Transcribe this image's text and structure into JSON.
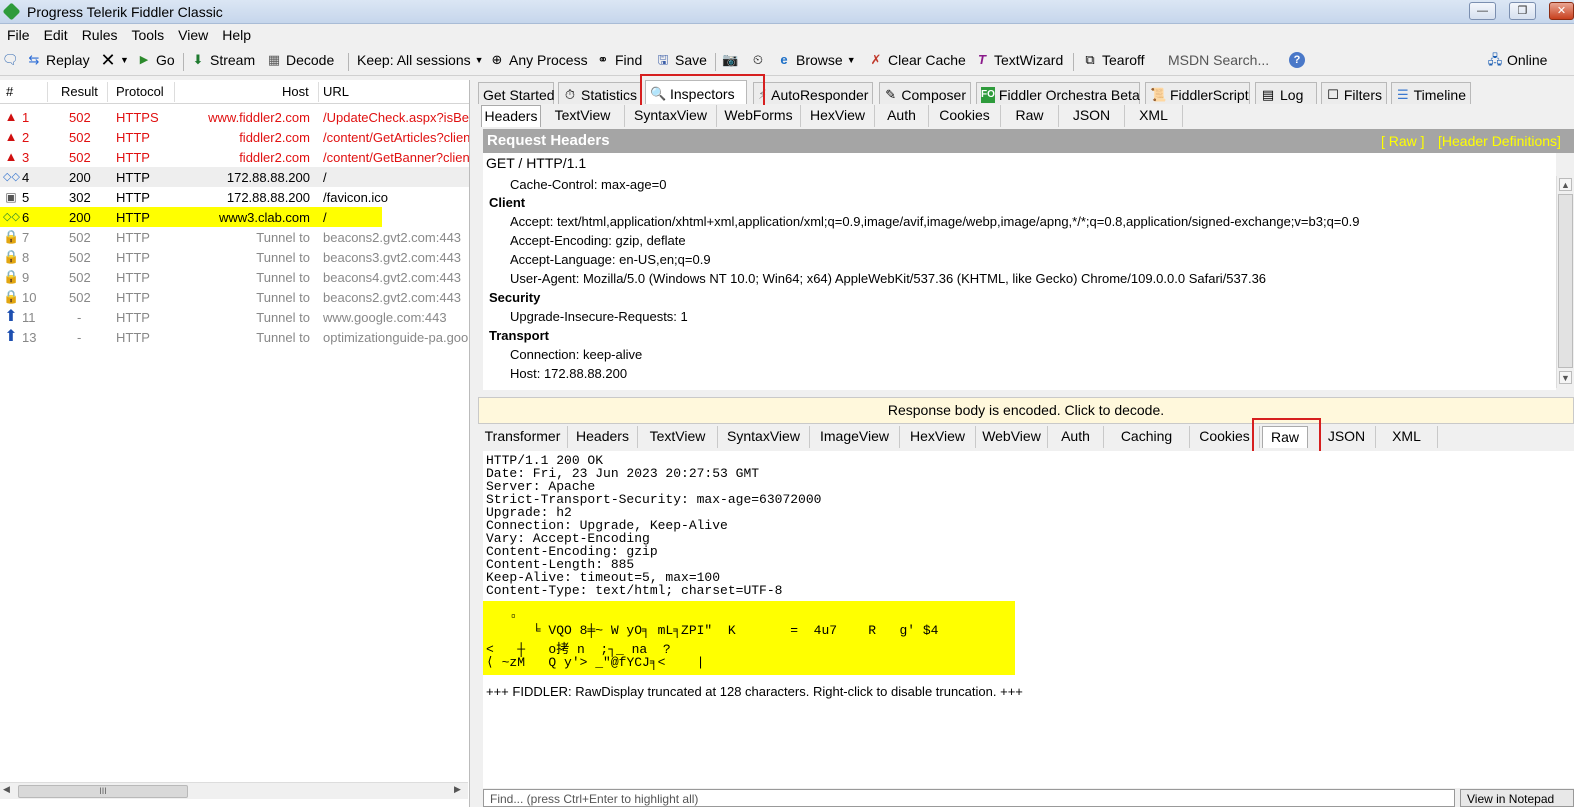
{
  "window": {
    "title": "Progress Telerik Fiddler Classic"
  },
  "menu": [
    "File",
    "Edit",
    "Rules",
    "Tools",
    "View",
    "Help"
  ],
  "toolbar": {
    "replay": "Replay",
    "go": "Go",
    "stream": "Stream",
    "decode": "Decode",
    "keep": "Keep: All sessions",
    "any_process": "Any Process",
    "find": "Find",
    "save": "Save",
    "browse": "Browse",
    "clear_cache": "Clear Cache",
    "textwizard": "TextWizard",
    "tearoff": "Tearoff",
    "msdn_search": "MSDN Search...",
    "online": "Online"
  },
  "sessions": {
    "columns": {
      "num": "#",
      "result": "Result",
      "protocol": "Protocol",
      "host": "Host",
      "url": "URL"
    },
    "rows": [
      {
        "num": "1",
        "result": "502",
        "protocol": "HTTPS",
        "host": "www.fiddler2.com",
        "url": "/UpdateCheck.aspx?isBet"
      },
      {
        "num": "2",
        "result": "502",
        "protocol": "HTTP",
        "host": "fiddler2.com",
        "url": "/content/GetArticles?clien"
      },
      {
        "num": "3",
        "result": "502",
        "protocol": "HTTP",
        "host": "fiddler2.com",
        "url": "/content/GetBanner?clien"
      },
      {
        "num": "4",
        "result": "200",
        "protocol": "HTTP",
        "host": "172.88.88.200",
        "url": "/"
      },
      {
        "num": "5",
        "result": "302",
        "protocol": "HTTP",
        "host": "172.88.88.200",
        "url": "/favicon.ico"
      },
      {
        "num": "6",
        "result": "200",
        "protocol": "HTTP",
        "host": "www3.clab.com",
        "url": "/"
      },
      {
        "num": "7",
        "result": "502",
        "protocol": "HTTP",
        "host": "Tunnel to",
        "url": "beacons2.gvt2.com:443"
      },
      {
        "num": "8",
        "result": "502",
        "protocol": "HTTP",
        "host": "Tunnel to",
        "url": "beacons3.gvt2.com:443"
      },
      {
        "num": "9",
        "result": "502",
        "protocol": "HTTP",
        "host": "Tunnel to",
        "url": "beacons4.gvt2.com:443"
      },
      {
        "num": "10",
        "result": "502",
        "protocol": "HTTP",
        "host": "Tunnel to",
        "url": "beacons2.gvt2.com:443"
      },
      {
        "num": "11",
        "result": "-",
        "protocol": "HTTP",
        "host": "Tunnel to",
        "url": "www.google.com:443"
      },
      {
        "num": "13",
        "result": "-",
        "protocol": "HTTP",
        "host": "Tunnel to",
        "url": "optimizationguide-pa.goo"
      }
    ],
    "scroll_thumb": "III"
  },
  "main_tabs": [
    "Get Started",
    "Statistics",
    "Inspectors",
    "AutoResponder",
    "Composer",
    "Fiddler Orchestra Beta",
    "FiddlerScript",
    "Log",
    "Filters",
    "Timeline"
  ],
  "fo_badge": "FO",
  "request_tabs": [
    "Headers",
    "TextView",
    "SyntaxView",
    "WebForms",
    "HexView",
    "Auth",
    "Cookies",
    "Raw",
    "JSON",
    "XML"
  ],
  "request_headers": {
    "title": "Request Headers",
    "raw_link": "[ Raw ]",
    "defs_link": "[Header Definitions]",
    "request_line": "GET / HTTP/1.1",
    "cache_control": "Cache-Control: max-age=0",
    "client_label": "Client",
    "accept": "Accept: text/html,application/xhtml+xml,application/xml;q=0.9,image/avif,image/webp,image/apng,*/*;q=0.8,application/signed-exchange;v=b3;q=0.9",
    "accept_encoding": "Accept-Encoding: gzip, deflate",
    "accept_language": "Accept-Language: en-US,en;q=0.9",
    "user_agent": "User-Agent: Mozilla/5.0 (Windows NT 10.0; Win64; x64) AppleWebKit/537.36 (KHTML, like Gecko) Chrome/109.0.0.0 Safari/537.36",
    "security_label": "Security",
    "upgrade_insecure": "Upgrade-Insecure-Requests: 1",
    "transport_label": "Transport",
    "connection": "Connection: keep-alive",
    "host": "Host: 172.88.88.200"
  },
  "decode_notice": "Response body is encoded. Click to decode.",
  "response_tabs": [
    "Transformer",
    "Headers",
    "TextView",
    "SyntaxView",
    "ImageView",
    "HexView",
    "WebView",
    "Auth",
    "Caching",
    "Cookies",
    "Raw",
    "JSON",
    "XML"
  ],
  "response_raw": {
    "headers": "HTTP/1.1 200 OK\nDate: Fri, 23 Jun 2023 20:27:53 GMT\nServer: Apache\nStrict-Transport-Security: max-age=63072000\nUpgrade: h2\nConnection: Upgrade, Keep-Alive\nVary: Accept-Encoding\nContent-Encoding: gzip\nContent-Length: 885\nKeep-Alive: timeout=5, max=100\nContent-Type: text/html; charset=UTF-8",
    "binary_line1": "   ▫",
    "binary_line2": "      ╘ VQO 8╪~ W yO╕ mL╕ZPI\"  K       =  4u7    R   g' $4",
    "binary_line3": "<   ┼   o拷 n  ;┐_ na  ?",
    "binary_line4": "⟨ ~zM   Q y'> _\"@fYCJ╕<    |",
    "truncation_note": "+++ FIDDLER: RawDisplay truncated at 128 characters. Right-click to disable truncation. +++"
  },
  "find_placeholder": "Find... (press Ctrl+Enter to highlight all)",
  "notepad_button": "View in Notepad",
  "colors": {
    "error_red": "#e01010",
    "highlight_yellow": "#ffff00",
    "callout_red": "#d61f1f"
  }
}
